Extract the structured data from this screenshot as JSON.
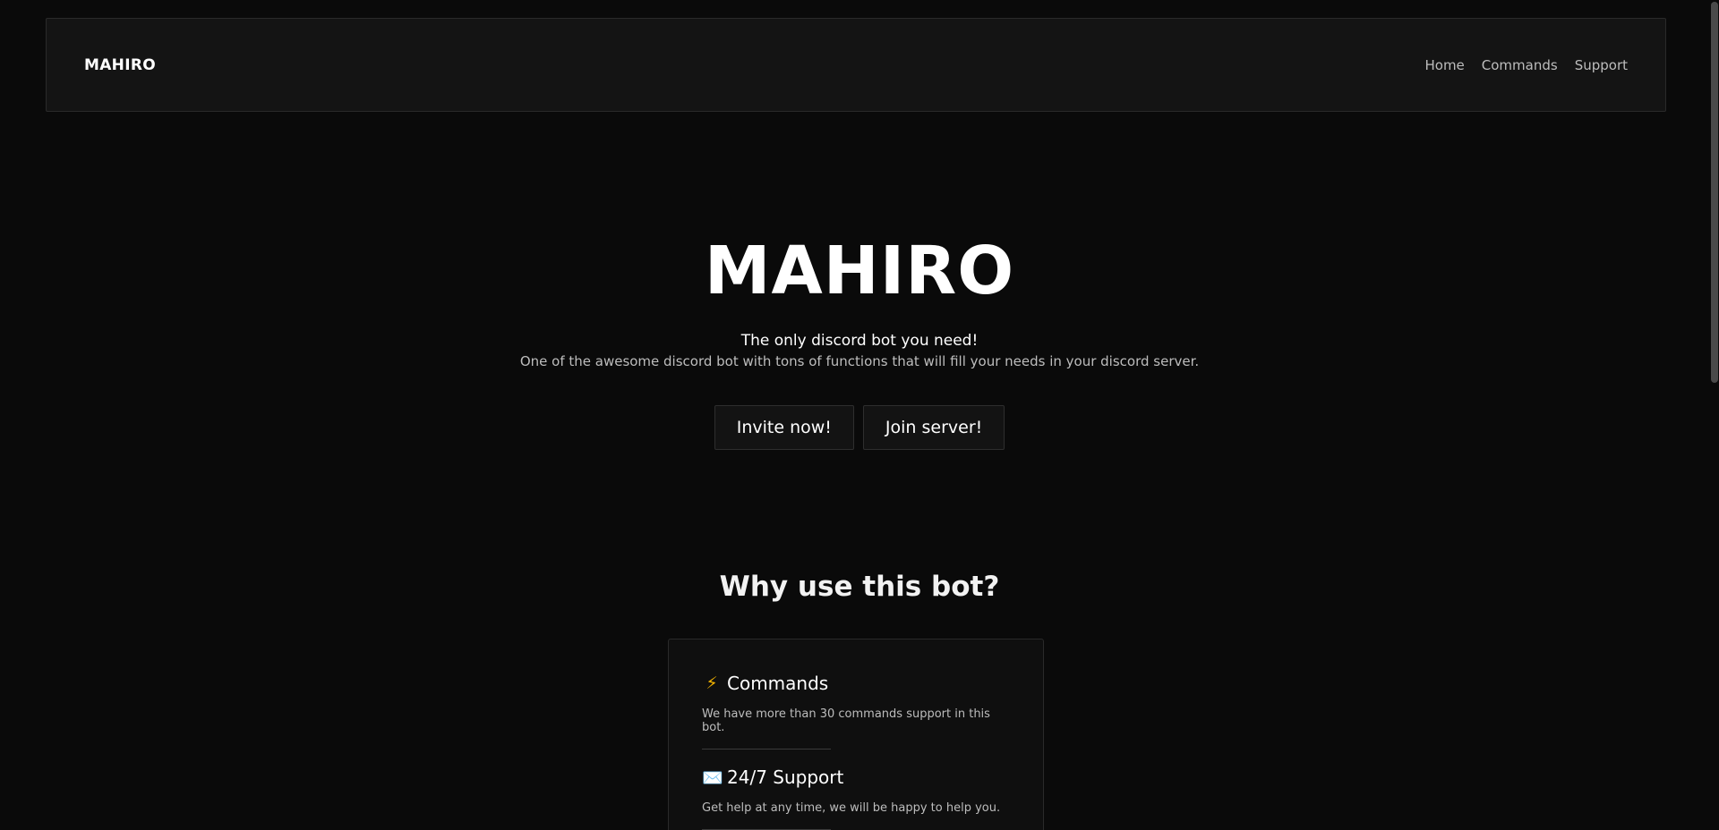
{
  "nav": {
    "brand": "MAHIRO",
    "links": [
      "Home",
      "Commands",
      "Support"
    ]
  },
  "hero": {
    "title": "MAHIRO",
    "tagline": "The only discord bot you need!",
    "description": "One of the awesome discord bot with tons of functions that will fill your needs in your discord server.",
    "buttons": {
      "invite": "Invite now!",
      "join": "Join server!"
    }
  },
  "features": {
    "title": "Why use this bot?",
    "items": [
      {
        "icon": "lightning-icon",
        "glyph": "⚡",
        "title": "Commands",
        "description": "We have more than 30 commands support in this bot."
      },
      {
        "icon": "envelope-icon",
        "glyph": "✉️",
        "title": "24/7 Support",
        "description": "Get help at any time, we will be happy to help you."
      }
    ]
  },
  "colors": {
    "background": "#0a0a0a",
    "surface": "#141414",
    "border": "#2a2a2a",
    "text_primary": "#ffffff",
    "text_secondary": "#bdbdbd"
  }
}
